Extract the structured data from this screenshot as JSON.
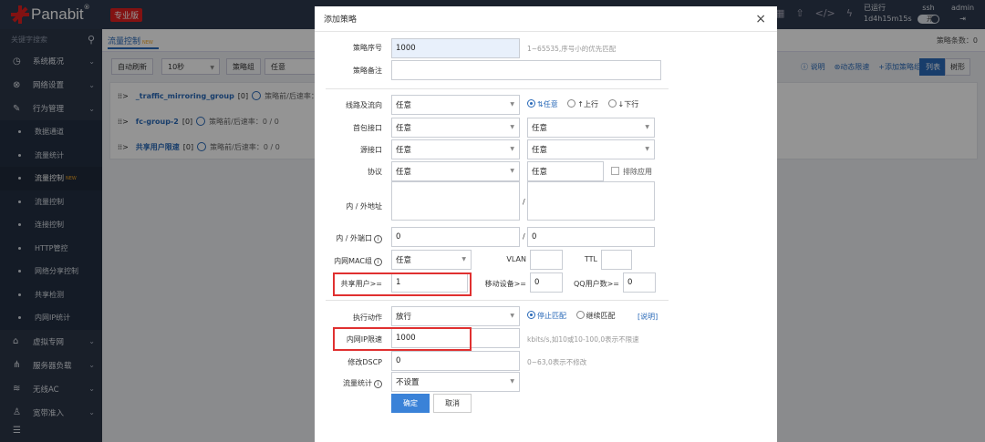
{
  "app": {
    "brand": "Panabit",
    "edition_badge": "专业版"
  },
  "status": {
    "uptime_label": "已运行",
    "uptime_value": "1d4h15m15s",
    "ssh_label": "ssh",
    "ssh_toggle": "开",
    "user": "admin"
  },
  "sidebar": {
    "search_placeholder": "关键字搜索",
    "items": [
      {
        "label": "系统概况"
      },
      {
        "label": "网络设置"
      },
      {
        "label": "行为管理"
      }
    ],
    "sub_items": [
      {
        "label": "数据通道"
      },
      {
        "label": "流量统计"
      },
      {
        "label": "流量控制",
        "badge": "NEW",
        "active": true
      },
      {
        "label": "流量控制"
      },
      {
        "label": "连接控制"
      },
      {
        "label": "HTTP管控"
      },
      {
        "label": "网络分享控制"
      },
      {
        "label": "共享检测"
      },
      {
        "label": "内网IP统计"
      }
    ],
    "bottom_items": [
      {
        "label": "虚拟专网"
      },
      {
        "label": "服务器负载"
      },
      {
        "label": "无线AC"
      },
      {
        "label": "宽带准入"
      }
    ]
  },
  "main": {
    "tab_label": "流量控制",
    "tab_badge": "NEW",
    "policy_count": "策略条数：0",
    "toolbar": {
      "auto_refresh": "自动刷新",
      "interval": "10秒",
      "group_btn": "策略组",
      "group_value": "任意",
      "help": "说明",
      "dynamic_limit": "动态限速",
      "add_group": "添加策略组",
      "list": "列表",
      "tree": "树形"
    },
    "groups": [
      {
        "name": "_traffic_mirroring_group",
        "count": "[0]",
        "meta": "策略前/后速率："
      },
      {
        "name": "fc-group-2",
        "count": "[0]",
        "meta": "策略前/后速率：0 / 0"
      },
      {
        "name": "共享用户限速",
        "count": "[0]",
        "meta": "策略前/后速率：0 / 0"
      }
    ]
  },
  "modal": {
    "title": "添加策略",
    "policy_no_label": "策略序号",
    "policy_no_value": "1000",
    "policy_no_hint": "1~65535,序号小的优先匹配",
    "remark_label": "策略备注",
    "line_dir_label": "线路及流向",
    "line_value": "任意",
    "dir_any": "任意",
    "dir_up": "上行",
    "dir_down": "下行",
    "first_if_label": "首包接口",
    "first_if_a": "任意",
    "first_if_b": "任意",
    "src_if_label": "源接口",
    "src_if_a": "任意",
    "src_if_b": "任意",
    "proto_label": "协议",
    "proto_a": "任意",
    "proto_b": "任意",
    "exclude_app": "排除应用",
    "addr_label": "内 / 外地址",
    "port_label": "内 / 外端口",
    "port_in": "0",
    "port_out": "0",
    "mac_group_label": "内网MAC组",
    "mac_group_value": "任意",
    "vlan_label": "VLAN",
    "ttl_label": "TTL",
    "shared_users_label": "共享用户>=",
    "shared_users_value": "1",
    "mobile_dev_label": "移动设备>=",
    "mobile_dev_value": "0",
    "qq_users_label": "QQ用户数>=",
    "qq_users_value": "0",
    "action_label": "执行动作",
    "action_value": "放行",
    "stop_match": "停止匹配",
    "continue_match": "继续匹配",
    "action_help": "[说明]",
    "ip_limit_label": "内网IP限速",
    "ip_limit_value": "1000",
    "ip_limit_hint": "kbits/s,如10或10-100,0表示不限速",
    "dscp_label": "修改DSCP",
    "dscp_value": "0",
    "dscp_hint": "0~63,0表示不修改",
    "stats_label": "流量统计",
    "stats_value": "不设置",
    "ok": "确定",
    "cancel": "取消"
  }
}
